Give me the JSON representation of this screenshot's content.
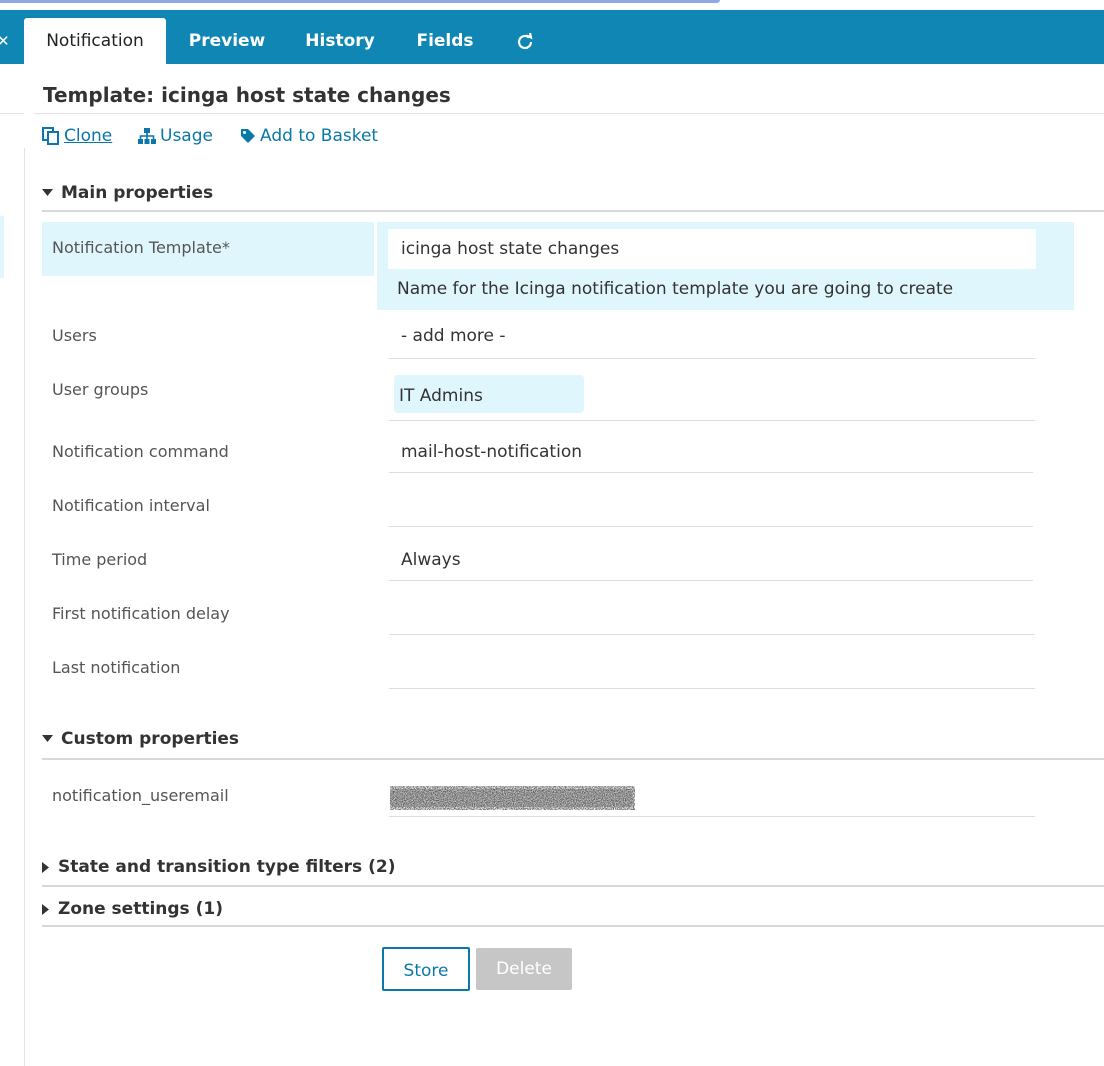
{
  "tabs": [
    {
      "label": "Notification"
    },
    {
      "label": "Preview"
    },
    {
      "label": "History"
    },
    {
      "label": "Fields"
    }
  ],
  "page": {
    "title": "Template: icinga host state changes"
  },
  "actions": {
    "clone": "Clone",
    "usage": "Usage",
    "basket": "Add to Basket"
  },
  "sections": {
    "main": "Main properties",
    "custom": "Custom properties",
    "filters": "State and transition type filters (2)",
    "zone": "Zone settings (1)"
  },
  "main": {
    "template_label": "Notification Template*",
    "template_value": "icinga host state changes",
    "template_hint": "Name for the Icinga notification template you are going to create",
    "users_label": "Users",
    "users_value": "- add more -",
    "usergroups_label": "User groups",
    "usergroups_value": "IT Admins",
    "command_label": "Notification command",
    "command_value": "mail-host-notification",
    "interval_label": "Notification interval",
    "interval_value": "",
    "period_label": "Time period",
    "period_value": "Always",
    "delay_label": "First notification delay",
    "delay_value": "",
    "last_label": "Last notification",
    "last_value": ""
  },
  "custom": {
    "useremail_label": "notification_useremail"
  },
  "buttons": {
    "store": "Store",
    "delete": "Delete"
  },
  "colors": {
    "accent": "#0f86b3",
    "link": "#0a78a8",
    "highlight": "#dff6fd"
  }
}
